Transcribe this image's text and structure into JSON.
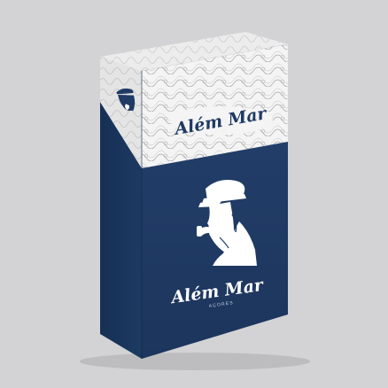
{
  "product": {
    "brand_top": "Além Mar",
    "brand_front": "Além Mar",
    "brand_sub": "AÇORES",
    "colors": {
      "background": "#d3d3d5",
      "navy": "#1f3a63",
      "navy_side": "#1a3256",
      "label_white": "#f4f4f4",
      "label_side": "#e6e6e6",
      "pattern": "#9a9a9a"
    },
    "icons": [
      "sailor-portrait-icon",
      "wave-pattern"
    ]
  }
}
